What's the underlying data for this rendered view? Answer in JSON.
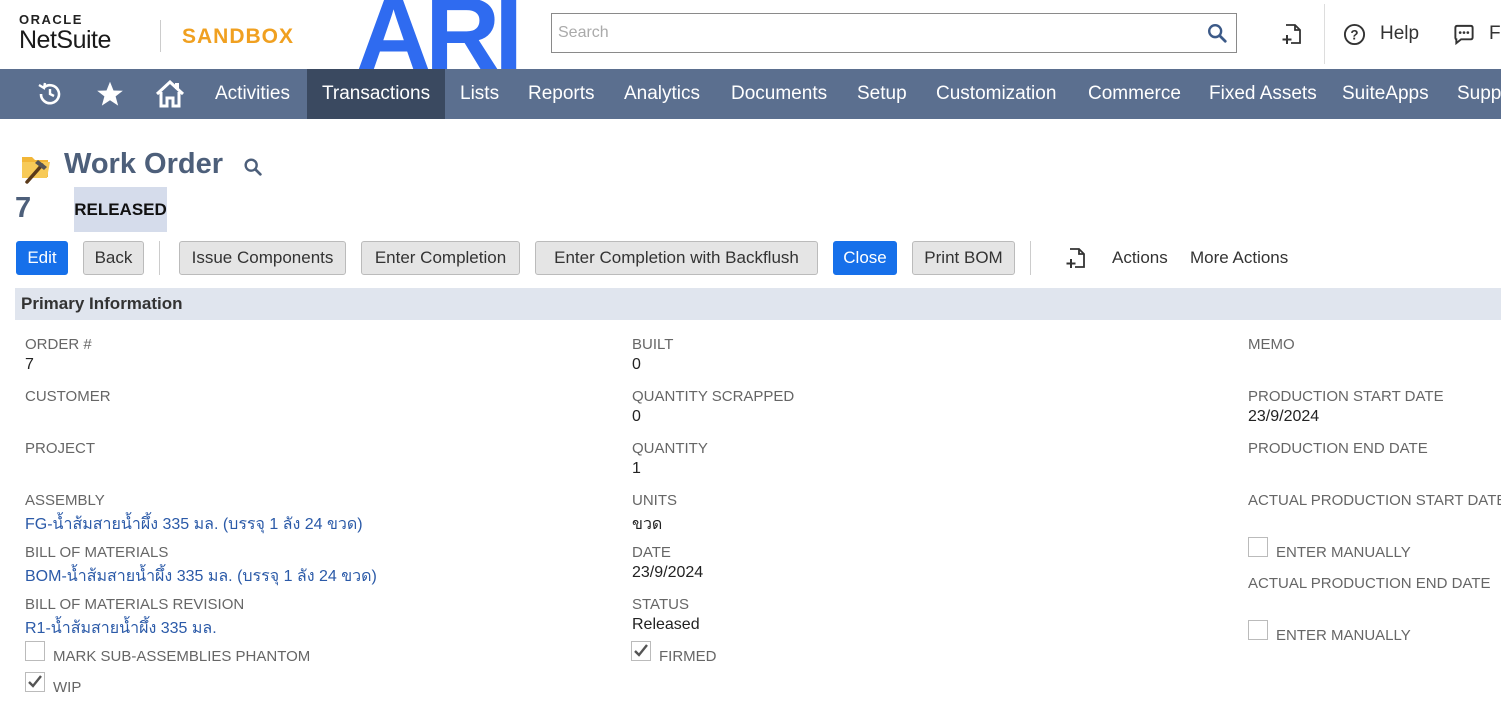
{
  "header": {
    "logo_oracle": "ORACLE",
    "logo_netsuite": "NetSuite",
    "environment": "SANDBOX",
    "brand_mark": "ARI",
    "search_placeholder": "Search",
    "help_label": "Help",
    "feedback_label": "Fe"
  },
  "nav": {
    "items": [
      "Activities",
      "Transactions",
      "Lists",
      "Reports",
      "Analytics",
      "Documents",
      "Setup",
      "Customization",
      "Commerce",
      "Fixed Assets",
      "SuiteApps",
      "Supp"
    ],
    "active": "Transactions"
  },
  "page": {
    "title": "Work Order",
    "record_number": "7",
    "status": "RELEASED"
  },
  "toolbar": {
    "edit": "Edit",
    "back": "Back",
    "issue_components": "Issue Components",
    "enter_completion": "Enter Completion",
    "enter_completion_backflush": "Enter Completion with Backflush",
    "close": "Close",
    "print_bom": "Print BOM",
    "actions": "Actions",
    "more_actions": "More Actions"
  },
  "section": {
    "title": "Primary Information"
  },
  "fields": {
    "order_num": {
      "label": "Order #",
      "value": "7"
    },
    "customer": {
      "label": "Customer",
      "value": ""
    },
    "project": {
      "label": "Project",
      "value": ""
    },
    "assembly": {
      "label": "Assembly",
      "value": "FG-น้ำส้มสายน้ำผึ้ง 335 มล. (บรรจุ 1 ลัง 24 ขวด)"
    },
    "bom": {
      "label": "Bill of Materials",
      "value": "BOM-น้ำส้มสายน้ำผึ้ง 335 มล. (บรรจุ 1 ลัง 24 ขวด)"
    },
    "bom_revision": {
      "label": "Bill of Materials Revision",
      "value": "R1-น้ำส้มสายน้ำผึ้ง 335 มล."
    },
    "mark_phantom": {
      "label": "Mark Sub-Assemblies Phantom",
      "checked": false
    },
    "wip": {
      "label": "WIP",
      "checked": true
    },
    "built": {
      "label": "Built",
      "value": "0"
    },
    "qty_scrapped": {
      "label": "Quantity Scrapped",
      "value": "0"
    },
    "quantity": {
      "label": "Quantity",
      "value": "1"
    },
    "units": {
      "label": "Units",
      "value": "ขวด"
    },
    "date": {
      "label": "Date",
      "value": "23/9/2024"
    },
    "status": {
      "label": "Status",
      "value": "Released"
    },
    "firmed": {
      "label": "Firmed",
      "checked": true
    },
    "memo": {
      "label": "Memo",
      "value": ""
    },
    "prod_start": {
      "label": "Production Start Date",
      "value": "23/9/2024"
    },
    "prod_end": {
      "label": "Production End Date",
      "value": ""
    },
    "actual_start": {
      "label": "Actual Production Start Date",
      "value": ""
    },
    "actual_start_manual": {
      "label": "Enter Manually",
      "checked": false
    },
    "actual_end": {
      "label": "Actual Production End Date",
      "value": ""
    },
    "actual_end_manual": {
      "label": "Enter Manually",
      "checked": false
    }
  },
  "colors": {
    "nav_bg": "#5b6f8f",
    "nav_active": "#3a4960",
    "primary_button": "#1670ea",
    "sandbox": "#f0a020",
    "brand_blue": "#2f6bf0",
    "link": "#2b5aa8"
  },
  "icons": {
    "recent": "history-icon",
    "favorites": "star-icon",
    "home": "home-icon",
    "search": "search-icon",
    "create": "new-record-icon",
    "help": "help-icon",
    "feedback": "chat-icon",
    "record": "work-order-icon"
  }
}
